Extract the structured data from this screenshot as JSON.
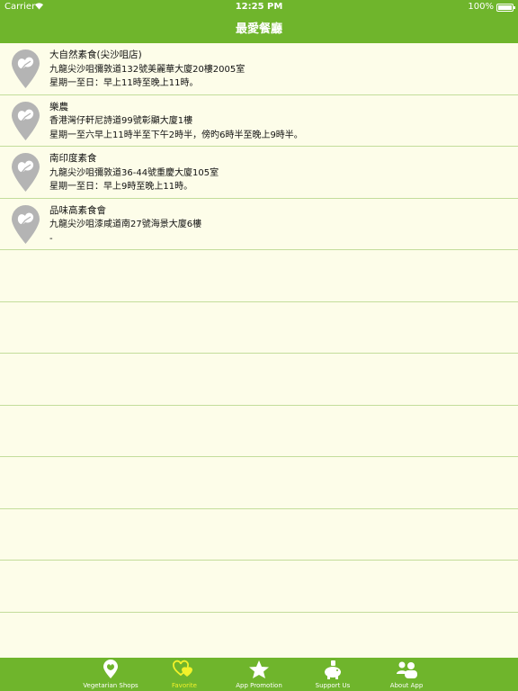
{
  "status": {
    "carrier": "Carrier",
    "time": "12:25 PM",
    "battery": "100%"
  },
  "nav": {
    "title": "最愛餐廳"
  },
  "restaurants": [
    {
      "name": "大自然素食(尖沙咀店)",
      "address": "九龍尖沙咀彌敦道132號美麗華大廈20樓2005室",
      "hours": "星期一至日：早上11時至晚上11時。"
    },
    {
      "name": "樂農",
      "address": "香港灣仔軒尼詩道99號彰顯大廈1樓",
      "hours": "星期一至六早上11時半至下午2時半，傍旳6時半至晚上9時半。"
    },
    {
      "name": "南印度素食",
      "address": "九龍尖沙咀彌敦道36-44號重慶大廈105室",
      "hours": "星期一至日：早上9時至晚上11時。"
    },
    {
      "name": "品味高素食會",
      "address": "九龍尖沙咀漆咸道南27號海景大廈6樓",
      "hours": "-"
    }
  ],
  "tabs": [
    {
      "label": "Vegetarian Shops",
      "icon": "leaf-pin-icon",
      "active": false
    },
    {
      "label": "Favorite",
      "icon": "hearts-icon",
      "active": true
    },
    {
      "label": "App Promotion",
      "icon": "star-icon",
      "active": false
    },
    {
      "label": "Support Us",
      "icon": "piggy-bank-icon",
      "active": false
    },
    {
      "label": "About App",
      "icon": "people-icon",
      "active": false
    }
  ],
  "colors": {
    "bar": "#6fb52c",
    "background": "#fdfde9",
    "separator": "#c3dd9b",
    "active_tab": "#f2f22a",
    "pin": "#b4b4b4"
  }
}
